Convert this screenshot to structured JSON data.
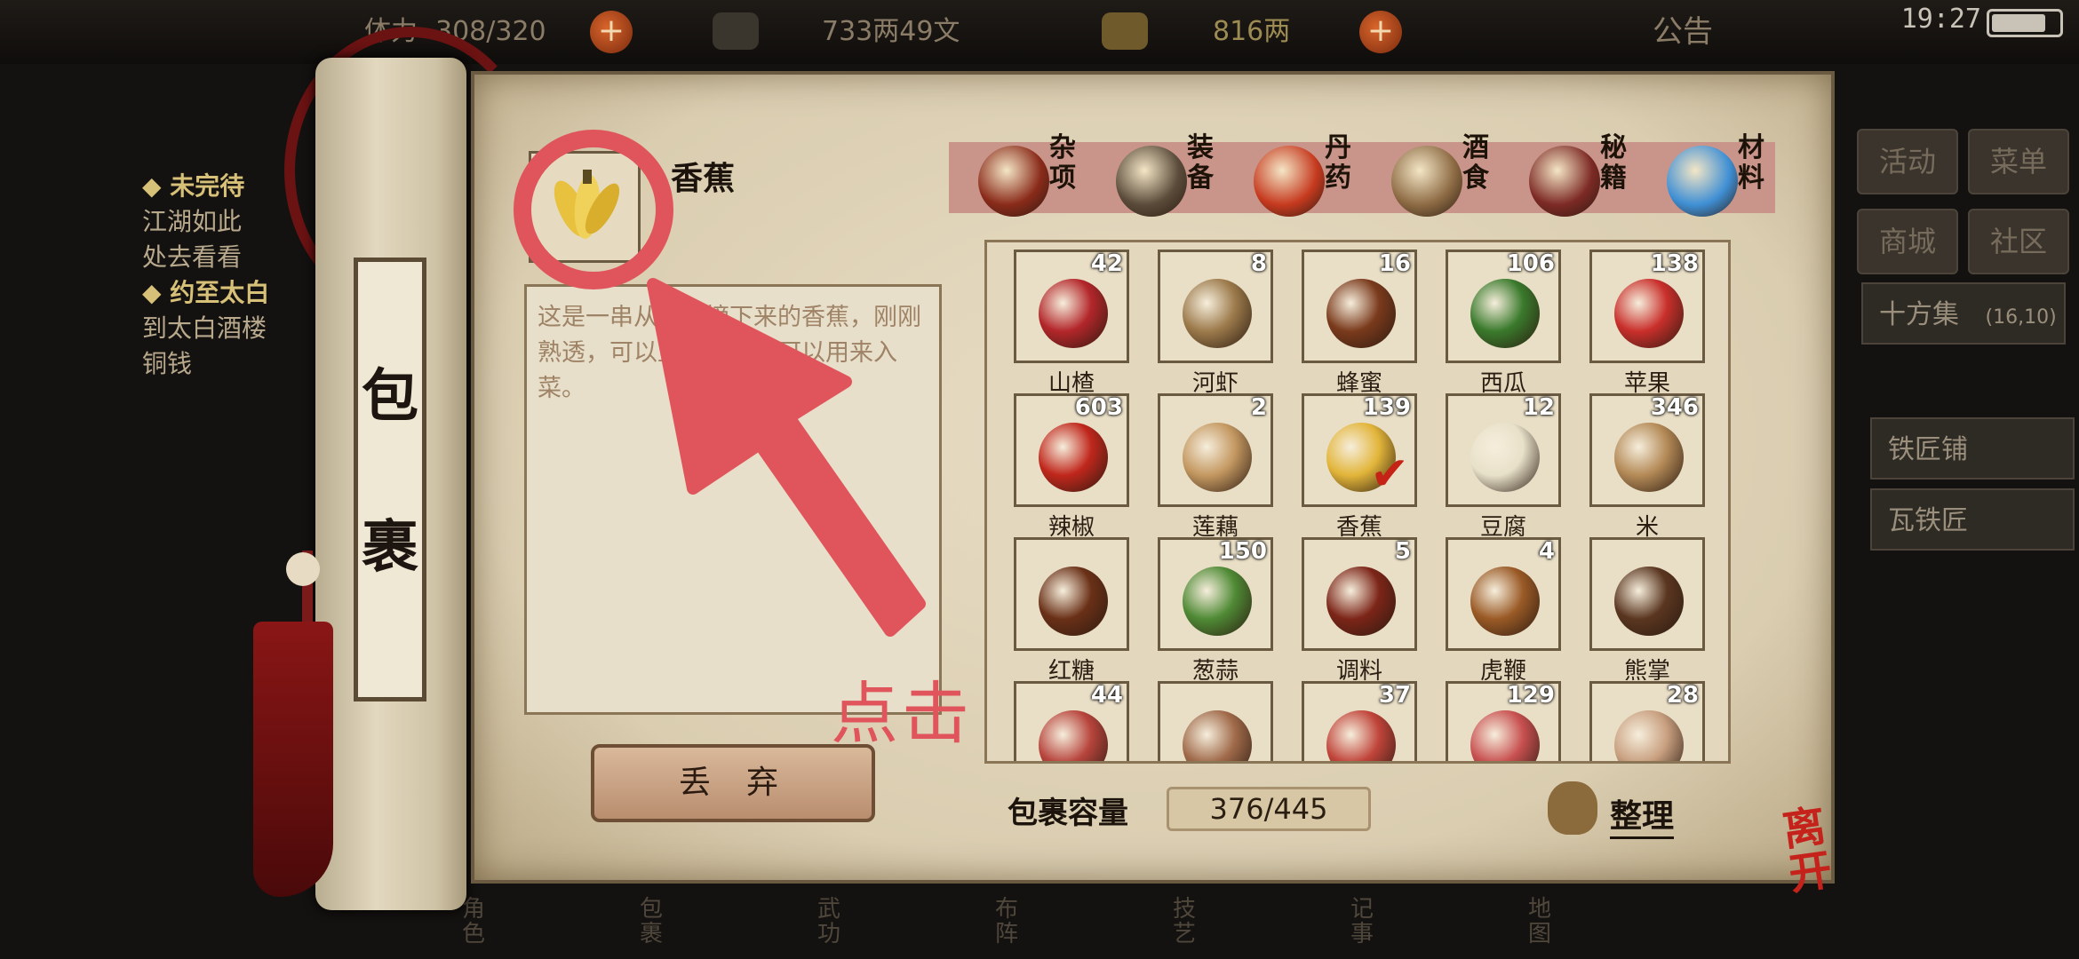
{
  "status": {
    "stamina_label": "体力",
    "stamina_value": "308/320",
    "money": "733两49文",
    "gold": "816两",
    "plus": "+",
    "notice": "公告",
    "time": "19:27"
  },
  "quests": {
    "q1_title": "◆ 未完待",
    "q1_line1": "江湖如此",
    "q1_line2": "处去看看",
    "q2_title": "◆ 约至太白",
    "q2_line1": "到太白酒楼",
    "q2_line2": "铜钱"
  },
  "side_menu": {
    "activity": "活动",
    "menu": "菜单",
    "shop": "商城",
    "community": "社区",
    "location": "十方集",
    "coords": "(16,10)",
    "blacksmith_shop": "铁匠铺",
    "blacksmith": "瓦铁匠"
  },
  "bottom_nav": [
    "角色",
    "包裹",
    "武功",
    "布阵",
    "技艺",
    "记事",
    "地图"
  ],
  "scroll_title_1": "包",
  "scroll_title_2": "裹",
  "selected": {
    "name": "香蕉",
    "description": "这是一串从树上摘下来的香蕉，刚刚熟透，可以直接食用也可以用来入菜。",
    "discard": "丢弃"
  },
  "tabs": [
    {
      "label": "杂项",
      "color": "#8a2b1a"
    },
    {
      "label": "装备",
      "color": "#5a4b3a"
    },
    {
      "label": "丹药",
      "color": "#c63a1f"
    },
    {
      "label": "酒食",
      "color": "#8d6b44"
    },
    {
      "label": "秘籍",
      "color": "#7d2a25"
    },
    {
      "label": "材料",
      "color": "#3f8fd4"
    }
  ],
  "items": [
    {
      "name": "山楂",
      "count": "42",
      "color": "#b3262a"
    },
    {
      "name": "河虾",
      "count": "8",
      "color": "#9c7a4b"
    },
    {
      "name": "蜂蜜",
      "count": "16",
      "color": "#7a3a1c"
    },
    {
      "name": "西瓜",
      "count": "106",
      "color": "#3a7a2c"
    },
    {
      "name": "苹果",
      "count": "138",
      "color": "#c92f2b"
    },
    {
      "name": "辣椒",
      "count": "603",
      "color": "#c0271c"
    },
    {
      "name": "莲藕",
      "count": "2",
      "color": "#c49861"
    },
    {
      "name": "香蕉",
      "count": "139",
      "color": "#e2b53a"
    },
    {
      "name": "豆腐",
      "count": "12",
      "color": "#e8e1c9"
    },
    {
      "name": "米",
      "count": "346",
      "color": "#b48a57"
    },
    {
      "name": "红糖",
      "count": "",
      "color": "#6a3017"
    },
    {
      "name": "葱蒜",
      "count": "150",
      "color": "#4f8a35"
    },
    {
      "name": "调料",
      "count": "5",
      "color": "#7c2518"
    },
    {
      "name": "虎鞭",
      "count": "4",
      "color": "#9a5a26"
    },
    {
      "name": "熊掌",
      "count": "",
      "color": "#5a3620"
    },
    {
      "name": "",
      "count": "44",
      "color": "#b7443c"
    },
    {
      "name": "",
      "count": "",
      "color": "#a06a4a"
    },
    {
      "name": "",
      "count": "37",
      "color": "#c0443a"
    },
    {
      "name": "",
      "count": "129",
      "color": "#c85050"
    },
    {
      "name": "",
      "count": "28",
      "color": "#c9a080"
    }
  ],
  "capacity_label": "包裹容量",
  "capacity_value": "376/445",
  "sort_label": "整理",
  "leave_label": "离开",
  "tap_hint": "点击",
  "accent": "#e0555c"
}
